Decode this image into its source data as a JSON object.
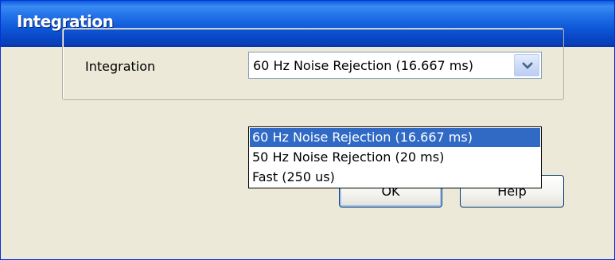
{
  "window": {
    "title": "Integration"
  },
  "form": {
    "integration_label": "Integration",
    "integration_select": {
      "selected": "60 Hz Noise Rejection (16.667 ms)",
      "options": [
        "60 Hz Noise Rejection (16.667 ms)",
        "50 Hz Noise Rejection (20 ms)",
        "Fast (250 us)"
      ],
      "highlighted_index": 0,
      "expanded": true
    }
  },
  "buttons": {
    "ok_label": "OK",
    "help_label": "Help"
  },
  "icons": {
    "dropdown_arrow": "chevron-down-icon"
  },
  "colors": {
    "titlebar": "#0a5ddb",
    "selection": "#316ac5",
    "dialog_bg": "#ece9d8"
  }
}
